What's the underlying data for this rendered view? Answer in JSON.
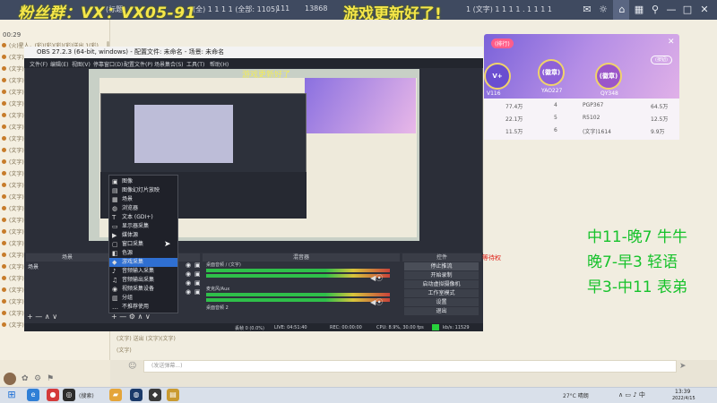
{
  "topbar": {
    "watermark_left": "粉丝群：VX：VX05-91",
    "watermark_right": "游戏更新好了!",
    "items": [
      "1号机",
      "(标题)",
      "主页",
      "(全) 1 1 1 1 (全部: 1105)",
      "111",
      "13868",
      "(文字)",
      "1 (文字) 1 1 1 1 . 1 1 1 1"
    ]
  },
  "left_panel": {
    "time": "00:29",
    "chat_rows": [
      "(火)星人，(彩)(彩)(彩)(彩)送出 1(彩)",
      "(文字) 送出 ...",
      "(文字) 进入直播间",
      "(文字) 进入直播间",
      "(文字)",
      "(文字)",
      "(文字)",
      "(文字)",
      "(文字)",
      "(文字)",
      "(文字)",
      "(文字)",
      "(文字)",
      "(文字)",
      "(文字)",
      "(文字)",
      "(文字)",
      "(文字)",
      "(文字)",
      "(文字)",
      "(文字)",
      "(文字)",
      "(文字)",
      "(文字)",
      "(文字)"
    ]
  },
  "rank_card": {
    "tab": "(排行)",
    "button": "(按钮)",
    "badges": [
      {
        "label": "V+",
        "sub": "116",
        "name": "V116"
      },
      {
        "label": "(徽章)",
        "sub": "",
        "name": "YAO227"
      },
      {
        "label": "(徽章)",
        "sub": "",
        "name": "QY348"
      }
    ],
    "rows": [
      {
        "left": "77.4万",
        "rank": "4",
        "name": "PGP367",
        "score": "64.5万"
      },
      {
        "left": "22.1万",
        "rank": "5",
        "name": "R5102",
        "score": "12.5万"
      },
      {
        "left": "11.5万",
        "rank": "6",
        "name": "(文字)1614",
        "score": "9.9万"
      }
    ]
  },
  "schedule": {
    "lines": [
      "中11-晚7 牛牛",
      "晚7-早3 轻语",
      "早3-中11 表弟"
    ]
  },
  "obs": {
    "title": "OBS 27.2.3 (64-bit, windows) - 配置文件: 未命名 - 场景: 未命名",
    "menu": [
      "文件(F)",
      "编辑(E)",
      "视图(V)",
      "停靠窗口(D)",
      "配置文件(P)",
      "场景集合(S)",
      "工具(T)",
      "帮助(H)"
    ],
    "preview_watermark": "游戏更新好了",
    "docks": {
      "scenes_header": "场景",
      "sources_header": "来源",
      "mixer_header": "混音器",
      "controls_header": "控件",
      "scene_item": "场景",
      "mixer_tracks": [
        {
          "label": "桌面音频 / (文字)",
          "value": "0.0 dB"
        },
        {
          "label": "麦克风/Aux",
          "value": "0.0 dB"
        },
        {
          "label": "桌面音频 2",
          "value": "0.0 dB"
        }
      ],
      "controls": [
        "停止推流",
        "开始录制",
        "启动虚拟摄像机",
        "工作室模式",
        "设置",
        "退出",
        "(文字)"
      ]
    },
    "statusbar": [
      "丢帧 0 (0.0%)",
      "LIVE: 04:51:40",
      "REC: 00:00:00",
      "CPU: 8.9%, 30.00 fps",
      "kb/s: 11529"
    ],
    "context_menu": [
      {
        "icon": "image",
        "label": "图像"
      },
      {
        "icon": "slideshow",
        "label": "图像幻灯片放映"
      },
      {
        "icon": "scene",
        "label": "场景"
      },
      {
        "icon": "browser",
        "label": "浏览器"
      },
      {
        "icon": "text",
        "label": "文本 (GDI+)"
      },
      {
        "icon": "capture",
        "label": "显示器采集"
      },
      {
        "icon": "media",
        "label": "媒体源"
      },
      {
        "icon": "window",
        "label": "窗口采集"
      },
      {
        "icon": "color",
        "label": "色源"
      },
      {
        "icon": "game",
        "label": "游戏采集"
      },
      {
        "icon": "input",
        "label": "音频输入采集"
      },
      {
        "icon": "output",
        "label": "音频输出采集"
      },
      {
        "icon": "video",
        "label": "视频采集设备"
      },
      {
        "icon": "group",
        "label": "分组"
      },
      {
        "icon": "deprecated",
        "label": "不推荐使用"
      }
    ],
    "context_selected_index": 9
  },
  "danmaku_red": "等待权",
  "bottom_chat": [
    "(文字) 送出 (文字)(文字)",
    "(文字)"
  ],
  "chat_input_placeholder": "(发送弹幕...)",
  "taskbar": {
    "items": [
      "(搜索)",
      "(文字)",
      "(文字)",
      "(文字)",
      "(文字)",
      "(文字)",
      "(文字)",
      "(文字)"
    ],
    "tray_text": "27°C 晴朗",
    "time": "13:39",
    "date": "2022/4/15"
  }
}
